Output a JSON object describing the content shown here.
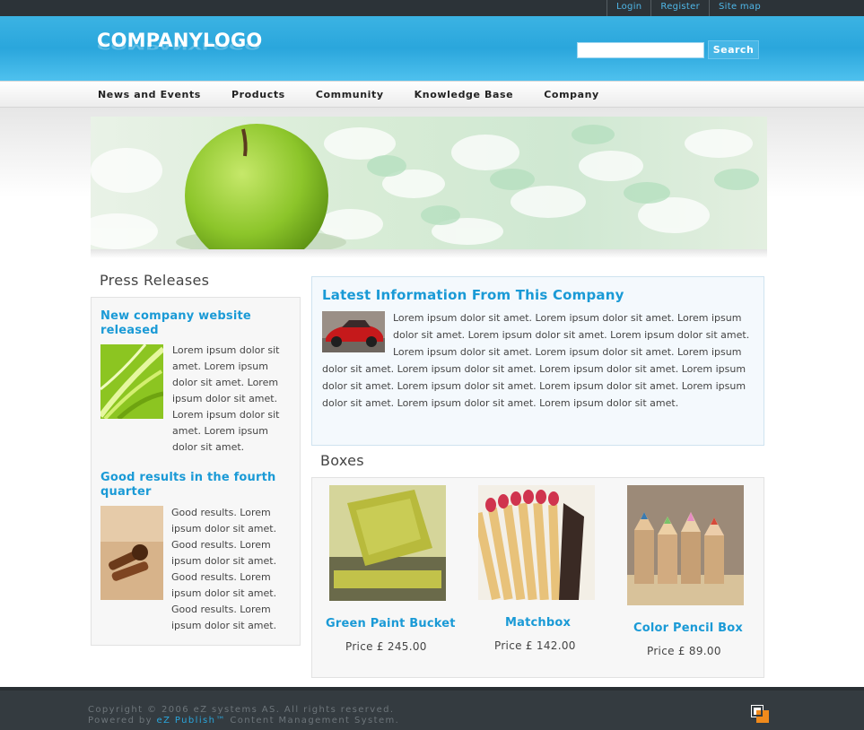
{
  "topbar": {
    "links": [
      "Login",
      "Register",
      "Site map"
    ]
  },
  "header": {
    "logo": "COMPANYLOGO",
    "search_placeholder": "",
    "search_button": "Search"
  },
  "nav": {
    "items": [
      "News and Events",
      "Products",
      "Community",
      "Knowledge Base",
      "Company"
    ]
  },
  "press": {
    "title": "Press Releases",
    "items": [
      {
        "title": "New company website released",
        "body": "Lorem ipsum dolor sit amet. Lorem ipsum dolor sit amet. Lorem ipsum dolor sit amet. Lorem ipsum dolor sit amet. Lorem ipsum dolor sit amet."
      },
      {
        "title": "Good results in the fourth quarter",
        "body": "Good results. Lorem ipsum dolor sit amet. Good results. Lorem ipsum dolor sit amet. Good results. Lorem ipsum dolor sit amet. Good results. Lorem ipsum dolor sit amet."
      }
    ]
  },
  "latest": {
    "title": "Latest Information From This Company",
    "body": "Lorem ipsum dolor sit amet. Lorem ipsum dolor sit amet. Lorem ipsum dolor sit amet. Lorem ipsum dolor sit amet. Lorem ipsum dolor sit amet. Lorem ipsum dolor sit amet. Lorem ipsum dolor sit amet. Lorem ipsum dolor sit amet. Lorem ipsum dolor sit amet. Lorem ipsum dolor sit amet. Lorem ipsum dolor sit amet. Lorem ipsum dolor sit amet. Lorem ipsum dolor sit amet. Lorem ipsum dolor sit amet. Lorem ipsum dolor sit amet. Lorem ipsum dolor sit amet."
  },
  "boxes": {
    "title": "Boxes",
    "products": [
      {
        "name": "Green Paint Bucket",
        "price": "Price £ 245.00"
      },
      {
        "name": "Matchbox",
        "price": "Price £ 142.00"
      },
      {
        "name": "Color Pencil Box",
        "price": "Price £ 89.00"
      }
    ]
  },
  "footer": {
    "line1": "Copyright © 2006 eZ systems AS. All rights reserved.",
    "line2_prefix": "Powered by ",
    "line2_link": "eZ Publish™",
    "line2_suffix": " Content Management System."
  },
  "colors": {
    "accent": "#1a9ad6",
    "header": "#2aa6dc",
    "footer": "#343b40"
  }
}
